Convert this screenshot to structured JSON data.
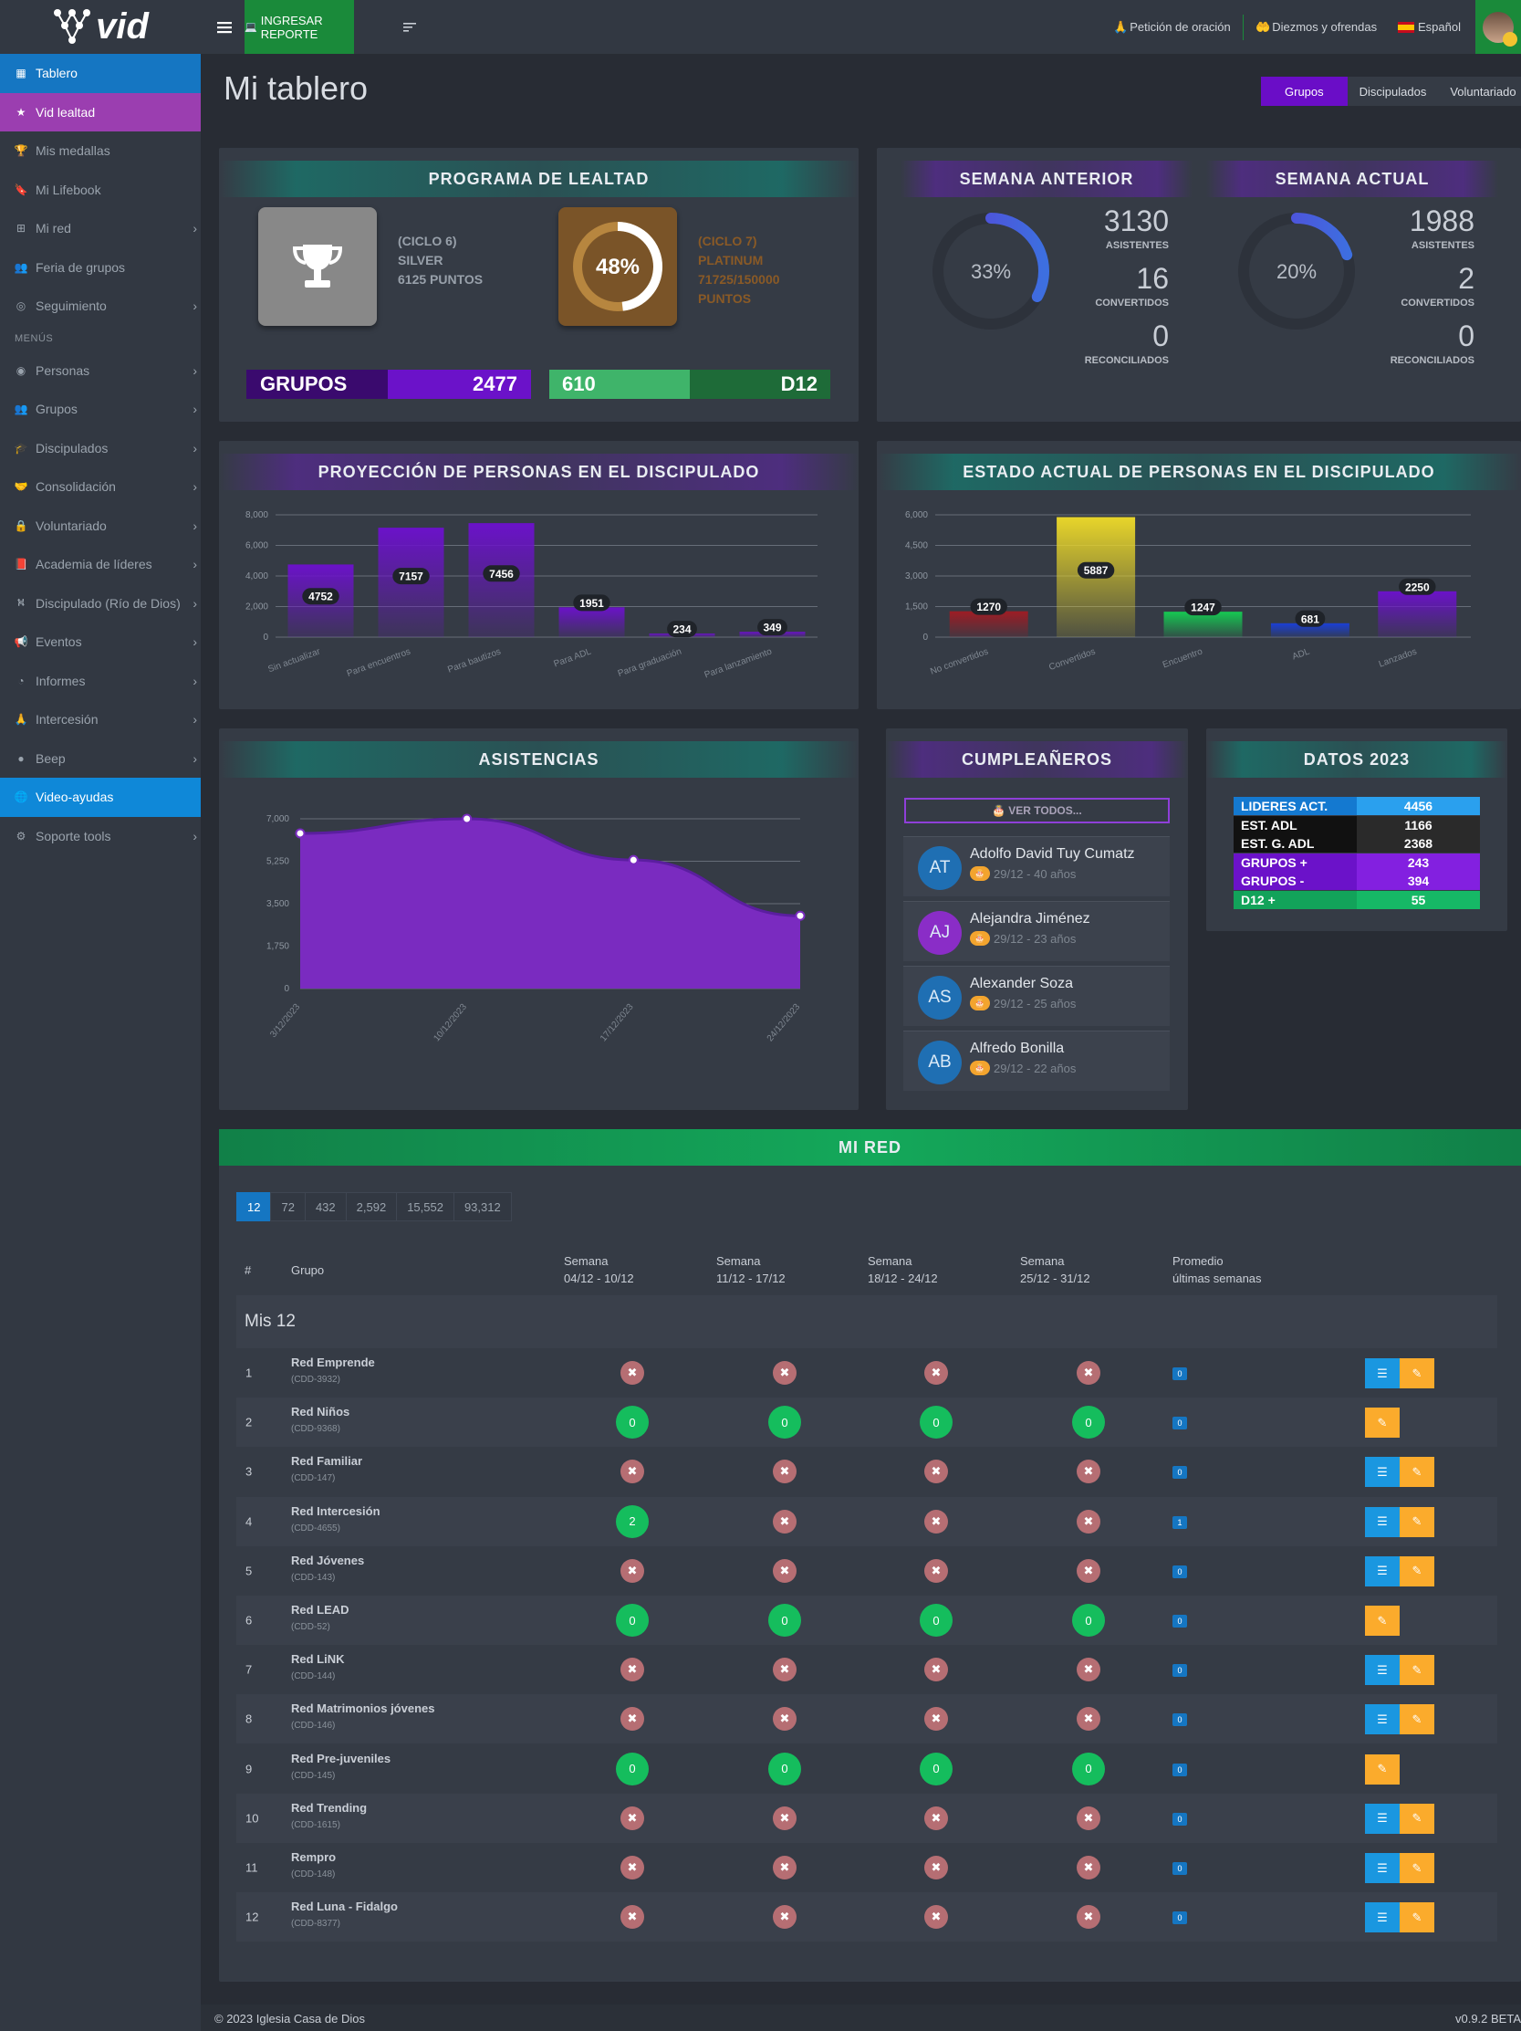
{
  "brand": {
    "logo_text": "vid"
  },
  "sidebar": {
    "items": [
      {
        "label": "Tablero",
        "icon": "grid-icon",
        "chevron": false,
        "style": "active"
      },
      {
        "label": "Vid lealtad",
        "icon": "star-icon",
        "chevron": false,
        "style": "purple"
      },
      {
        "label": "Mis medallas",
        "icon": "trophy-icon",
        "chevron": false,
        "style": ""
      },
      {
        "label": "Mi Lifebook",
        "icon": "bookmark-icon",
        "chevron": false,
        "style": ""
      },
      {
        "label": "Mi red",
        "icon": "sitemap-icon",
        "chevron": true,
        "style": ""
      },
      {
        "label": "Feria de grupos",
        "icon": "users-icon",
        "chevron": false,
        "style": ""
      },
      {
        "label": "Seguimiento",
        "icon": "target-icon",
        "chevron": true,
        "style": ""
      }
    ],
    "section_label": "MENÚS",
    "menu_items": [
      {
        "label": "Personas",
        "icon": "user-circle-icon",
        "chevron": true,
        "style": ""
      },
      {
        "label": "Grupos",
        "icon": "users-icon",
        "chevron": true,
        "style": ""
      },
      {
        "label": "Discipulados",
        "icon": "graduation-cap-icon",
        "chevron": true,
        "style": ""
      },
      {
        "label": "Consolidación",
        "icon": "handshake-icon",
        "chevron": true,
        "style": ""
      },
      {
        "label": "Voluntariado",
        "icon": "lock-icon",
        "chevron": true,
        "style": ""
      },
      {
        "label": "Academia de líderes",
        "icon": "book-icon",
        "chevron": true,
        "style": ""
      },
      {
        "label": "Discipulado (Río de Dios)",
        "icon": "road-icon",
        "chevron": true,
        "style": ""
      },
      {
        "label": "Eventos",
        "icon": "megaphone-icon",
        "chevron": true,
        "style": ""
      },
      {
        "label": "Informes",
        "icon": "pie-chart-icon",
        "chevron": true,
        "style": ""
      },
      {
        "label": "Intercesión",
        "icon": "praying-hands-icon",
        "chevron": true,
        "style": ""
      },
      {
        "label": "Beep",
        "icon": "beep-icon",
        "chevron": true,
        "style": ""
      },
      {
        "label": "Video-ayudas",
        "icon": "globe-icon",
        "chevron": false,
        "style": "blue"
      },
      {
        "label": "Soporte tools",
        "icon": "cogs-icon",
        "chevron": true,
        "style": ""
      }
    ]
  },
  "topbar": {
    "report_button": "INGRESAR REPORTE",
    "prayer_label": "Petición de oración",
    "tithes_label": "Diezmos y ofrendas",
    "language_label": "Español"
  },
  "page": {
    "title": "Mi tablero",
    "tabs": [
      "Grupos",
      "Discipulados",
      "Voluntariado"
    ]
  },
  "loyalty": {
    "title": "PROGRAMA DE LEALTAD",
    "current": {
      "cycle": "(CICLO 6)",
      "level": "SILVER",
      "points": "6125 PUNTOS"
    },
    "next": {
      "percent_label": "48%",
      "percent": 0.48,
      "cycle": "(CICLO 7)",
      "level": "PLATINUM",
      "points_line1": "71725/150000",
      "points_line2": "PUNTOS"
    },
    "groups_label": "GRUPOS",
    "groups_value": "2477",
    "d12_value": "610",
    "d12_label": "D12"
  },
  "weeks": [
    {
      "title": "SEMANA ANTERIOR",
      "percent_label": "33%",
      "percent": 0.33,
      "asistentes": "3130",
      "convertidos": "16",
      "reconciliados": "0"
    },
    {
      "title": "SEMANA ACTUAL",
      "percent_label": "20%",
      "percent": 0.2,
      "asistentes": "1988",
      "convertidos": "2",
      "reconciliados": "0"
    }
  ],
  "week_labels": {
    "asistentes": "ASISTENTES",
    "convertidos": "CONVERTIDOS",
    "reconciliados": "RECONCILIADOS"
  },
  "chart_data": [
    {
      "type": "bar",
      "title": "PROYECCIÓN DE PERSONAS EN EL DISCIPULADO",
      "categories": [
        "Sin actualizar",
        "Para encuentros",
        "Para bautizos",
        "Para ADL",
        "Para graduación",
        "Para lanzamiento"
      ],
      "values": [
        4752,
        7157,
        7456,
        1951,
        234,
        349
      ],
      "yticks": [
        "8,000",
        "6,000",
        "4,000",
        "2,000",
        "0"
      ],
      "ylim": [
        0,
        8000
      ],
      "colors": [
        "#6b12c9"
      ]
    },
    {
      "type": "bar",
      "title": "ESTADO ACTUAL DE PERSONAS EN EL DISCIPULADO",
      "categories": [
        "No convertidos",
        "Convertidos",
        "Encuentro",
        "ADL",
        "Lanzados"
      ],
      "values": [
        1270,
        5887,
        1247,
        681,
        2250
      ],
      "yticks": [
        "6,000",
        "4,500",
        "3,000",
        "1,500",
        "0"
      ],
      "ylim": [
        0,
        6000
      ],
      "colors": [
        "#9e1c24",
        "#e8d52a",
        "#16c952",
        "#1a3fd6",
        "#6b12c9"
      ]
    },
    {
      "type": "area",
      "title": "ASISTENCIAS",
      "x": [
        "3/12/2023",
        "10/12/2023",
        "17/12/2023",
        "24/12/2023"
      ],
      "values": [
        6400,
        7000,
        5300,
        3000
      ],
      "yticks": [
        "7,000",
        "5,250",
        "3,500",
        "1,750",
        "0"
      ],
      "ylim": [
        0,
        7000
      ]
    }
  ],
  "birthdays": {
    "title": "CUMPLEAÑEROS",
    "view_all": "VER TODOS...",
    "items": [
      {
        "initials": "AT",
        "name": "Adolfo David Tuy Cumatz",
        "date": "29/12 - 40 años",
        "color": "#1f6fb3"
      },
      {
        "initials": "AJ",
        "name": "Alejandra Jiménez",
        "date": "29/12 - 23 años",
        "color": "#8a2dc7"
      },
      {
        "initials": "AS",
        "name": "Alexander Soza",
        "date": "29/12 - 25 años",
        "color": "#1f6fb3"
      },
      {
        "initials": "AB",
        "name": "Alfredo Bonilla",
        "date": "29/12 - 22 años",
        "color": "#1f6fb3"
      }
    ]
  },
  "datos2023": {
    "title": "DATOS 2023",
    "rows": [
      {
        "label": "LIDERES ACT.",
        "value": "4456",
        "kc": "#1479d0",
        "vc": "#2aa0ee"
      },
      {
        "label": "EST. ADL",
        "value": "1166",
        "kc": "#111111",
        "vc": "#2a2a2a"
      },
      {
        "label": "EST. G. ADL",
        "value": "2368",
        "kc": "#111111",
        "vc": "#2a2a2a"
      },
      {
        "label": "GRUPOS +",
        "value": "243",
        "kc": "#6b12c9",
        "vc": "#8320e0"
      },
      {
        "label": "GRUPOS -",
        "value": "394",
        "kc": "#6b12c9",
        "vc": "#8320e0"
      },
      {
        "label": "D12 +",
        "value": "55",
        "kc": "#12a35a",
        "vc": "#16b866"
      }
    ]
  },
  "mired": {
    "title": "MI RED",
    "levels": [
      "12",
      "72",
      "432",
      "2,592",
      "15,552",
      "93,312"
    ],
    "headers": {
      "num": "#",
      "group": "Grupo",
      "w1a": "Semana",
      "w1b": "04/12 - 10/12",
      "w2a": "Semana",
      "w2b": "11/12 - 17/12",
      "w3a": "Semana",
      "w3b": "18/12 - 24/12",
      "w4a": "Semana",
      "w4b": "25/12 - 31/12",
      "avga": "Promedio",
      "avgb": "últimas semanas"
    },
    "section": "Mis 12",
    "rows": [
      {
        "n": "1",
        "name": "Red Emprende",
        "code": "(CDD-3932)",
        "w": [
          "x",
          "x",
          "x",
          "x"
        ],
        "avg": "0",
        "blue": true
      },
      {
        "n": "2",
        "name": "Red Niños",
        "code": "(CDD-9368)",
        "w": [
          "0",
          "0",
          "0",
          "0"
        ],
        "avg": "0",
        "blue": false
      },
      {
        "n": "3",
        "name": "Red Familiar",
        "code": "(CDD-147)",
        "w": [
          "x",
          "x",
          "x",
          "x"
        ],
        "avg": "0",
        "blue": true
      },
      {
        "n": "4",
        "name": "Red Intercesión",
        "code": "(CDD-4655)",
        "w": [
          "2",
          "x",
          "x",
          "x"
        ],
        "avg": "1",
        "blue": true
      },
      {
        "n": "5",
        "name": "Red Jóvenes",
        "code": "(CDD-143)",
        "w": [
          "x",
          "x",
          "x",
          "x"
        ],
        "avg": "0",
        "blue": true
      },
      {
        "n": "6",
        "name": "Red LEAD",
        "code": "(CDD-52)",
        "w": [
          "0",
          "0",
          "0",
          "0"
        ],
        "avg": "0",
        "blue": false
      },
      {
        "n": "7",
        "name": "Red LiNK",
        "code": "(CDD-144)",
        "w": [
          "x",
          "x",
          "x",
          "x"
        ],
        "avg": "0",
        "blue": true
      },
      {
        "n": "8",
        "name": "Red Matrimonios jóvenes",
        "code": "(CDD-146)",
        "w": [
          "x",
          "x",
          "x",
          "x"
        ],
        "avg": "0",
        "blue": true
      },
      {
        "n": "9",
        "name": "Red Pre-juveniles",
        "code": "(CDD-145)",
        "w": [
          "0",
          "0",
          "0",
          "0"
        ],
        "avg": "0",
        "blue": false
      },
      {
        "n": "10",
        "name": "Red Trending",
        "code": "(CDD-1615)",
        "w": [
          "x",
          "x",
          "x",
          "x"
        ],
        "avg": "0",
        "blue": true
      },
      {
        "n": "11",
        "name": "Rempro",
        "code": "(CDD-148)",
        "w": [
          "x",
          "x",
          "x",
          "x"
        ],
        "avg": "0",
        "blue": true
      },
      {
        "n": "12",
        "name": "Red Luna - Fidalgo",
        "code": "(CDD-8377)",
        "w": [
          "x",
          "x",
          "x",
          "x"
        ],
        "avg": "0",
        "blue": true
      }
    ]
  },
  "footer": {
    "copyright": "© 2023 Iglesia Casa de Dios",
    "version": "v0.9.2 BETA"
  }
}
